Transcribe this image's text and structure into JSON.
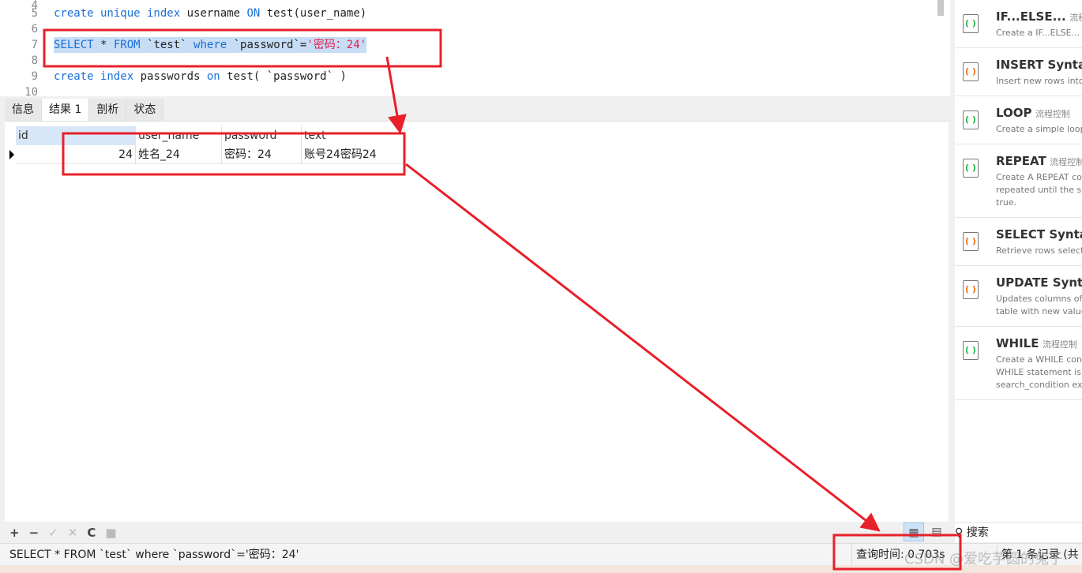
{
  "editor": {
    "lines": [
      {
        "n": "4",
        "code": ""
      },
      {
        "n": "5",
        "code": "create unique index username ON test(user_name)"
      },
      {
        "n": "6",
        "code": ""
      },
      {
        "n": "7",
        "code": "SELECT * FROM `test` where `password`='密码：24'"
      },
      {
        "n": "8",
        "code": ""
      },
      {
        "n": "9",
        "code": "create index passwords on test( `password` )"
      },
      {
        "n": "10",
        "code": ""
      }
    ]
  },
  "tabs": [
    "信息",
    "结果 1",
    "剖析",
    "状态"
  ],
  "grid": {
    "columns": [
      "id",
      "user_name",
      "password",
      "text"
    ],
    "rows": [
      [
        "24",
        "姓名_24",
        "密码：24",
        "账号24密码24"
      ]
    ]
  },
  "snippets": [
    {
      "title": "IF...ELSE...",
      "tag": "流程控制",
      "desc": "Create a IF...ELSE... co",
      "icon": "flow-icon"
    },
    {
      "title": "INSERT Syntax",
      "tag": "",
      "desc": "Insert new rows into",
      "icon": "syntax-icon"
    },
    {
      "title": "LOOP",
      "tag": "流程控制",
      "desc": "Create a simple loop",
      "icon": "flow-icon"
    },
    {
      "title": "REPEAT",
      "tag": "流程控制",
      "desc": "Create A REPEAT con repeated until the sea true.",
      "icon": "flow-icon"
    },
    {
      "title": "SELECT Syntax",
      "tag": "",
      "desc": "Retrieve rows selecte",
      "icon": "syntax-icon"
    },
    {
      "title": "UPDATE Synta",
      "tag": "",
      "desc": "Updates columns of table with new value",
      "icon": "syntax-icon"
    },
    {
      "title": "WHILE",
      "tag": "流程控制",
      "desc": "Create a WHILE const a WHILE statement is search_condition exp",
      "icon": "flow-icon"
    }
  ],
  "toolbar": {
    "add": "+",
    "remove": "−",
    "apply": "✓",
    "cancel": "✕",
    "refresh": "C",
    "stop": "■"
  },
  "search": {
    "label": "搜索"
  },
  "status": {
    "sql": "SELECT * FROM `test` where `password`='密码：24'",
    "query_time": "查询时间: 0.703s",
    "record": "第 1 条记录 (共"
  },
  "watermark": "CSDN @爱吃芋圆的兔子",
  "colors": {
    "annotation": "#e8202a",
    "keyword": "#1a6fd6",
    "string": "#e0204a",
    "selection": "#c7dcf5"
  }
}
